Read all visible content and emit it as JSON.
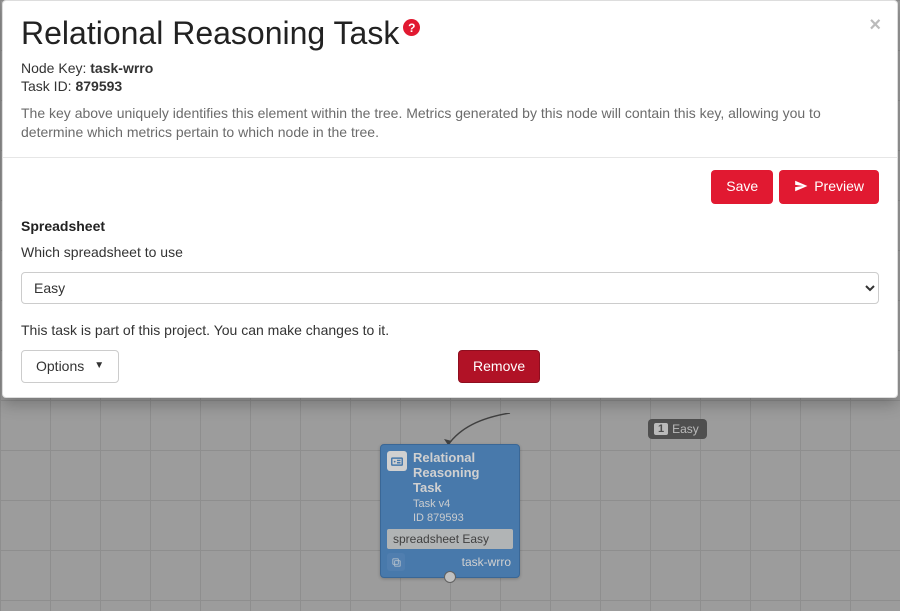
{
  "modal": {
    "title": "Relational Reasoning Task",
    "help_icon_label": "?",
    "close_label": "×",
    "node_key_label": "Node Key:",
    "node_key_value": "task-wrro",
    "task_id_label": "Task ID:",
    "task_id_value": "879593",
    "description": "The key above uniquely identifies this element within the tree. Metrics generated by this node will contain this key, allowing you to determine which metrics pertain to which node in the tree."
  },
  "actions": {
    "save_label": "Save",
    "preview_label": "Preview"
  },
  "spreadsheet": {
    "section_title": "Spreadsheet",
    "subtitle": "Which spreadsheet to use",
    "selected_value": "Easy"
  },
  "project_note": "This task is part of this project. You can make changes to it.",
  "bottom": {
    "options_label": "Options",
    "remove_label": "Remove"
  },
  "bg_node": {
    "title": "Relational Reasoning Task",
    "type_line": "Task v4",
    "id_line": "ID 879593",
    "bar_text": "spreadsheet Easy",
    "key": "task-wrro"
  },
  "bg_tag": {
    "num": "1",
    "label": "Easy"
  }
}
